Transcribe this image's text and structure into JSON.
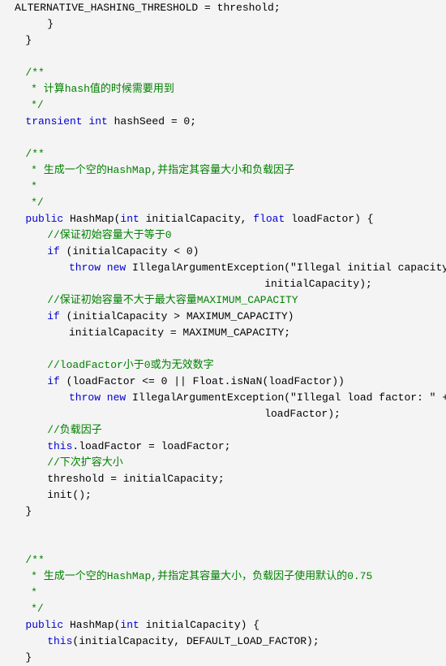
{
  "editor": {
    "language": "java",
    "background_color": "#f4f4f4",
    "keyword_color": "#0000D0",
    "comment_color": "#008000",
    "text_color": "#000000",
    "font_size_px": 13,
    "line_height_px": 20
  },
  "code_lines": [
    {
      "indent": 0,
      "tokens": [
        {
          "t": "pl",
          "s": "ALTERNATIVE_HASHING_THRESHOLD = threshold;"
        }
      ]
    },
    {
      "indent": 6,
      "tokens": [
        {
          "t": "pl",
          "s": "}"
        }
      ]
    },
    {
      "indent": 2,
      "tokens": [
        {
          "t": "pl",
          "s": "}"
        }
      ]
    },
    {
      "indent": 0,
      "tokens": []
    },
    {
      "indent": 2,
      "tokens": [
        {
          "t": "cm",
          "s": "/**"
        }
      ]
    },
    {
      "indent": 3,
      "tokens": [
        {
          "t": "cm",
          "s": "* 计算hash值的时候需要用到"
        }
      ]
    },
    {
      "indent": 3,
      "tokens": [
        {
          "t": "cm",
          "s": "*/"
        }
      ]
    },
    {
      "indent": 2,
      "tokens": [
        {
          "t": "kw",
          "s": "transient int"
        },
        {
          "t": "pl",
          "s": " hashSeed = 0;"
        }
      ]
    },
    {
      "indent": 0,
      "tokens": []
    },
    {
      "indent": 2,
      "tokens": [
        {
          "t": "cm",
          "s": "/**"
        }
      ]
    },
    {
      "indent": 3,
      "tokens": [
        {
          "t": "cm",
          "s": "* 生成一个空的HashMap,并指定其容量大小和负载因子"
        }
      ]
    },
    {
      "indent": 3,
      "tokens": [
        {
          "t": "cm",
          "s": "*"
        }
      ]
    },
    {
      "indent": 3,
      "tokens": [
        {
          "t": "cm",
          "s": "*/"
        }
      ]
    },
    {
      "indent": 2,
      "tokens": [
        {
          "t": "kw",
          "s": "public"
        },
        {
          "t": "pl",
          "s": " HashMap("
        },
        {
          "t": "kw",
          "s": "int"
        },
        {
          "t": "pl",
          "s": " initialCapacity, "
        },
        {
          "t": "kw",
          "s": "float"
        },
        {
          "t": "pl",
          "s": " loadFactor) {"
        }
      ]
    },
    {
      "indent": 6,
      "tokens": [
        {
          "t": "cm",
          "s": "//保证初始容量大于等于0"
        }
      ]
    },
    {
      "indent": 6,
      "tokens": [
        {
          "t": "kw",
          "s": "if"
        },
        {
          "t": "pl",
          "s": " (initialCapacity < 0)"
        }
      ]
    },
    {
      "indent": 10,
      "tokens": [
        {
          "t": "kw",
          "s": "throw new"
        },
        {
          "t": "pl",
          "s": " IllegalArgumentException(\"Illegal initial capacity: \" +"
        }
      ]
    },
    {
      "indent": 46,
      "tokens": [
        {
          "t": "pl",
          "s": "initialCapacity);"
        }
      ]
    },
    {
      "indent": 6,
      "tokens": [
        {
          "t": "cm",
          "s": "//保证初始容量不大于最大容量MAXIMUM_CAPACITY"
        }
      ]
    },
    {
      "indent": 6,
      "tokens": [
        {
          "t": "kw",
          "s": "if"
        },
        {
          "t": "pl",
          "s": " (initialCapacity > MAXIMUM_CAPACITY)"
        }
      ]
    },
    {
      "indent": 10,
      "tokens": [
        {
          "t": "pl",
          "s": "initialCapacity = MAXIMUM_CAPACITY;"
        }
      ]
    },
    {
      "indent": 0,
      "tokens": []
    },
    {
      "indent": 6,
      "tokens": [
        {
          "t": "cm",
          "s": "//loadFactor小于0或为无效数字"
        }
      ]
    },
    {
      "indent": 6,
      "tokens": [
        {
          "t": "kw",
          "s": "if"
        },
        {
          "t": "pl",
          "s": " (loadFactor <= 0 || Float.isNaN(loadFactor))"
        }
      ]
    },
    {
      "indent": 10,
      "tokens": [
        {
          "t": "kw",
          "s": "throw new"
        },
        {
          "t": "pl",
          "s": " IllegalArgumentException(\"Illegal load factor: \" +"
        }
      ]
    },
    {
      "indent": 46,
      "tokens": [
        {
          "t": "pl",
          "s": "loadFactor);"
        }
      ]
    },
    {
      "indent": 6,
      "tokens": [
        {
          "t": "cm",
          "s": "//负载因子"
        }
      ]
    },
    {
      "indent": 6,
      "tokens": [
        {
          "t": "kw",
          "s": "this"
        },
        {
          "t": "pl",
          "s": ".loadFactor = loadFactor;"
        }
      ]
    },
    {
      "indent": 6,
      "tokens": [
        {
          "t": "cm",
          "s": "//下次扩容大小"
        }
      ]
    },
    {
      "indent": 6,
      "tokens": [
        {
          "t": "pl",
          "s": "threshold = initialCapacity;"
        }
      ]
    },
    {
      "indent": 6,
      "tokens": [
        {
          "t": "pl",
          "s": "init();"
        }
      ]
    },
    {
      "indent": 2,
      "tokens": [
        {
          "t": "pl",
          "s": "}"
        }
      ]
    },
    {
      "indent": 0,
      "tokens": []
    },
    {
      "indent": 0,
      "tokens": []
    },
    {
      "indent": 2,
      "tokens": [
        {
          "t": "cm",
          "s": "/**"
        }
      ]
    },
    {
      "indent": 3,
      "tokens": [
        {
          "t": "cm",
          "s": "* 生成一个空的HashMap,并指定其容量大小，负载因子使用默认的0.75"
        }
      ]
    },
    {
      "indent": 3,
      "tokens": [
        {
          "t": "cm",
          "s": "*"
        }
      ]
    },
    {
      "indent": 3,
      "tokens": [
        {
          "t": "cm",
          "s": "*/"
        }
      ]
    },
    {
      "indent": 2,
      "tokens": [
        {
          "t": "kw",
          "s": "public"
        },
        {
          "t": "pl",
          "s": " HashMap("
        },
        {
          "t": "kw",
          "s": "int"
        },
        {
          "t": "pl",
          "s": " initialCapacity) {"
        }
      ]
    },
    {
      "indent": 6,
      "tokens": [
        {
          "t": "kw",
          "s": "this"
        },
        {
          "t": "pl",
          "s": "(initialCapacity, DEFAULT_LOAD_FACTOR);"
        }
      ]
    },
    {
      "indent": 2,
      "tokens": [
        {
          "t": "pl",
          "s": "}"
        }
      ]
    }
  ]
}
